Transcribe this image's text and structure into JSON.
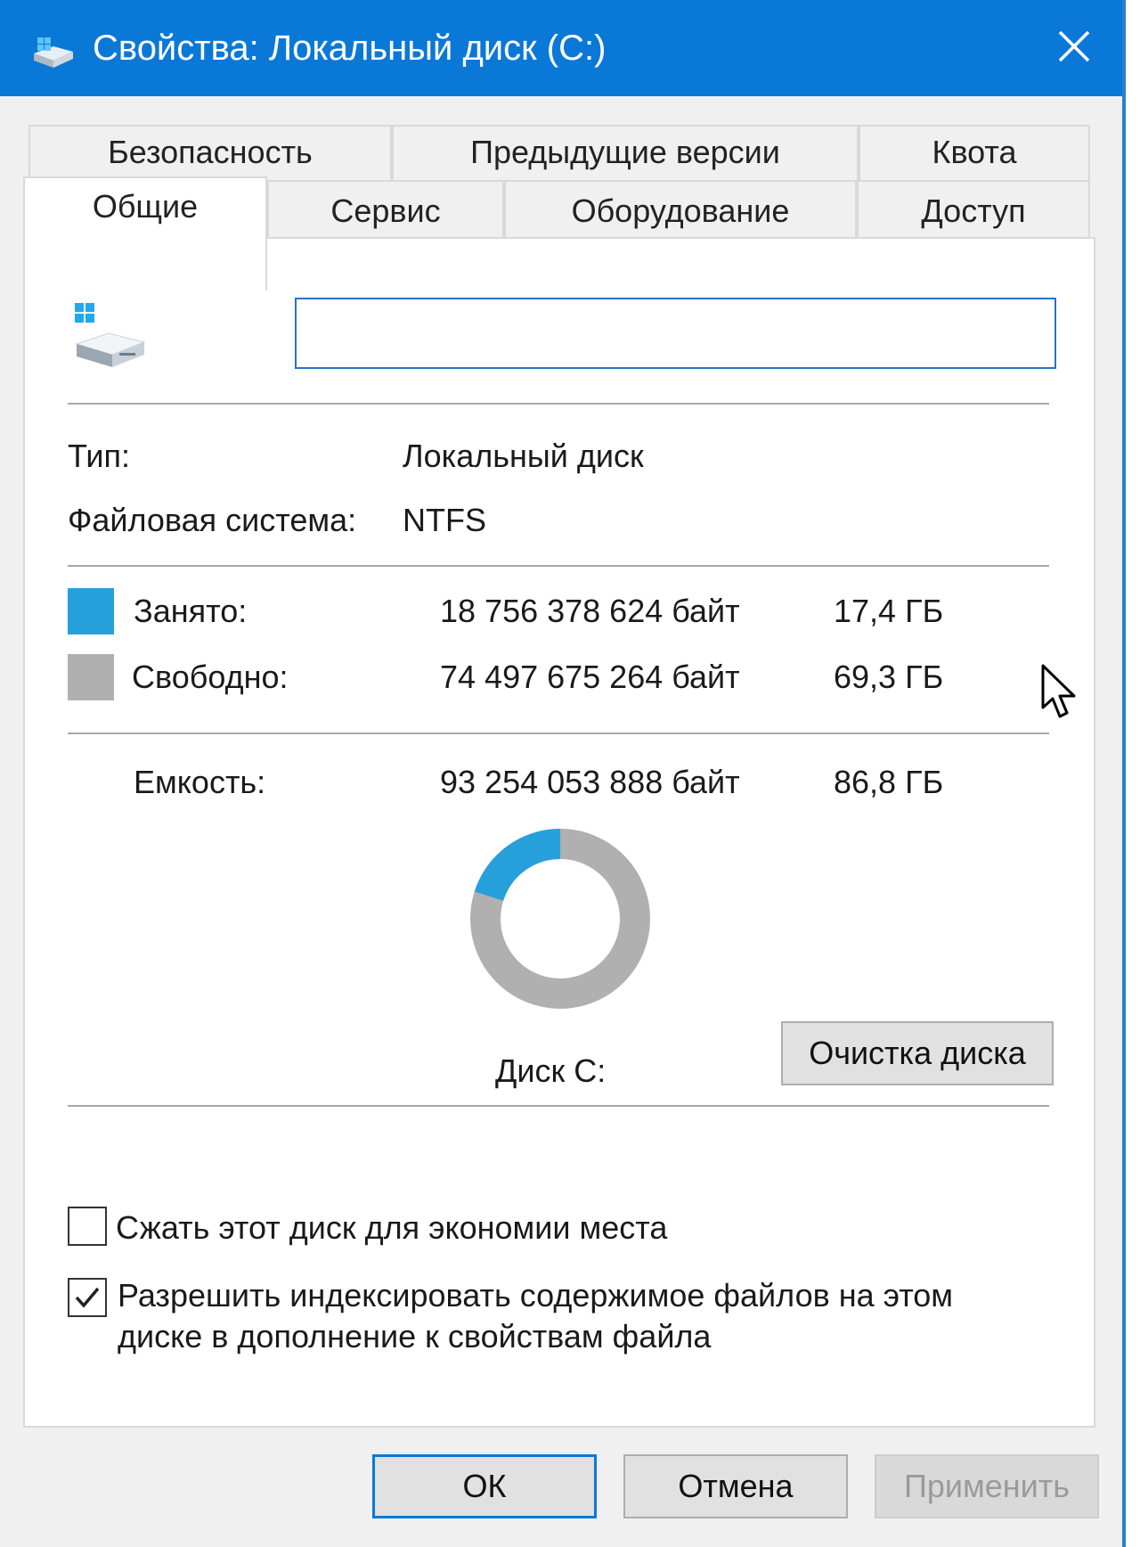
{
  "window": {
    "title": "Свойства: Локальный диск (C:)"
  },
  "tabs": {
    "security": "Безопасность",
    "previous_versions": "Предыдущие версии",
    "quota": "Квота",
    "general": "Общие",
    "tools": "Сервис",
    "hardware": "Оборудование",
    "sharing": "Доступ"
  },
  "general": {
    "volume_name_value": "",
    "type_label": "Тип:",
    "type_value": "Локальный диск",
    "fs_label": "Файловая система:",
    "fs_value": "NTFS",
    "used": {
      "label": "Занято:",
      "bytes": "18 756 378 624 байт",
      "size": "17,4 ГБ",
      "fraction": 0.2011
    },
    "free": {
      "label": "Свободно:",
      "bytes": "74 497 675 264 байт",
      "size": "69,3 ГБ",
      "fraction": 0.7989
    },
    "capacity": {
      "label": "Емкость:",
      "bytes": "93 254 053 888 байт",
      "size": "86,8 ГБ"
    },
    "disk_label": "Диск C:",
    "cleanup_button": "Очистка диска",
    "compress_label": "Сжать этот диск для экономии места",
    "compress_checked": false,
    "index_label_line1": "Разрешить индексировать содержимое файлов на этом",
    "index_label_line2": "диске в дополнение к свойствам файла",
    "index_checked": true
  },
  "buttons": {
    "ok": "ОК",
    "cancel": "Отмена",
    "apply": "Применить"
  },
  "colors": {
    "titlebar": "#0a78d7",
    "used": "#26a0da",
    "free": "#b0b0b0"
  },
  "icons": {
    "title": "drive-icon",
    "close": "close-icon",
    "drive": "windows-drive-icon",
    "cursor": "mouse-cursor"
  }
}
